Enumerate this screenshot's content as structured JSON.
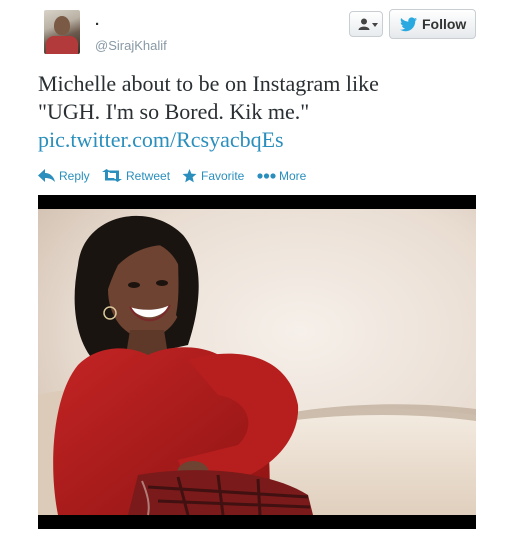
{
  "user": {
    "display_name": ".",
    "handle": "@SirajKhalif"
  },
  "header": {
    "follow_label": "Follow"
  },
  "tweet": {
    "text_line1": "Michelle about to be on Instagram like",
    "text_line2": "\"UGH. I'm so Bored. Kik me.\"",
    "link": "pic.twitter.com/RcsyacbqEs"
  },
  "actions": {
    "reply": "Reply",
    "retweet": "Retweet",
    "favorite": "Favorite",
    "more": "More"
  },
  "icons": {
    "user": "user-icon",
    "caret": "caret-down-icon",
    "bird": "twitter-bird-icon",
    "reply": "reply-icon",
    "retweet": "retweet-icon",
    "favorite": "star-icon",
    "more": "ellipsis-icon"
  },
  "colors": {
    "link": "#2a8fbd",
    "bird": "#2aa9e0",
    "handle": "#8899a6"
  }
}
